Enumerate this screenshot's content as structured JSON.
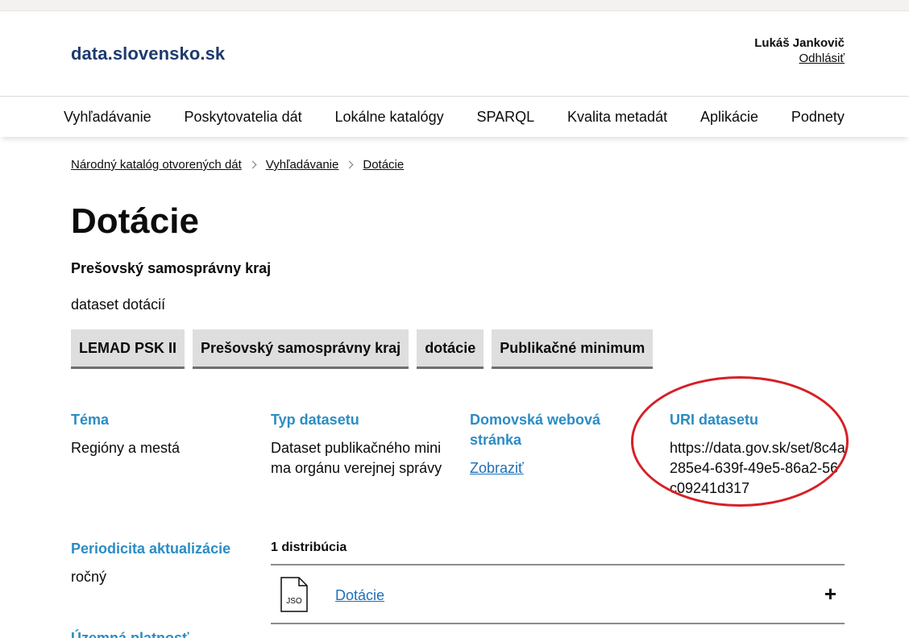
{
  "header": {
    "logo": "data.slovensko.sk",
    "user_name": "Lukáš Jankovič",
    "logout": "Odhlásiť"
  },
  "nav": {
    "items": [
      "Vyhľadávanie",
      "Poskytovatelia dát",
      "Lokálne katalógy",
      "SPARQL",
      "Kvalita metadát",
      "Aplikácie",
      "Podnety"
    ]
  },
  "breadcrumb": [
    "Národný katalóg otvorených dát",
    "Vyhľadávanie",
    "Dotácie"
  ],
  "dataset": {
    "title": "Dotácie",
    "publisher": "Prešovský samosprávny kraj",
    "description": "dataset dotácií",
    "tags": [
      "LEMAD PSK II",
      "Prešovský samosprávny kraj",
      "dotácie",
      "Publikačné minimum"
    ]
  },
  "meta": {
    "theme_label": "Téma",
    "theme_value": "Regióny a mestá",
    "type_label": "Typ datasetu",
    "type_value": "Dataset publikačného minima orgánu verejnej správy",
    "homepage_label": "Domovská webová stránka",
    "homepage_link": "Zobraziť",
    "uri_label": "URI datasetu",
    "uri_value": "https://data.gov.sk/set/8c4a285e4-639f-49e5-86a2-56c09241d317",
    "periodicity_label": "Periodicita aktualizácie",
    "periodicity_value": "ročný",
    "territory_label": "Územná platnosť"
  },
  "distributions": {
    "count_label": "1 distribúcia",
    "items": [
      {
        "format": "JSO",
        "name": "Dotácie",
        "toggle": "+"
      }
    ]
  },
  "colors": {
    "brand": "#1d3a6e",
    "label_blue": "#2b8cc4",
    "link_blue": "#1d70b8",
    "annotation_red": "#d62027",
    "tag_bg": "#dedede"
  }
}
